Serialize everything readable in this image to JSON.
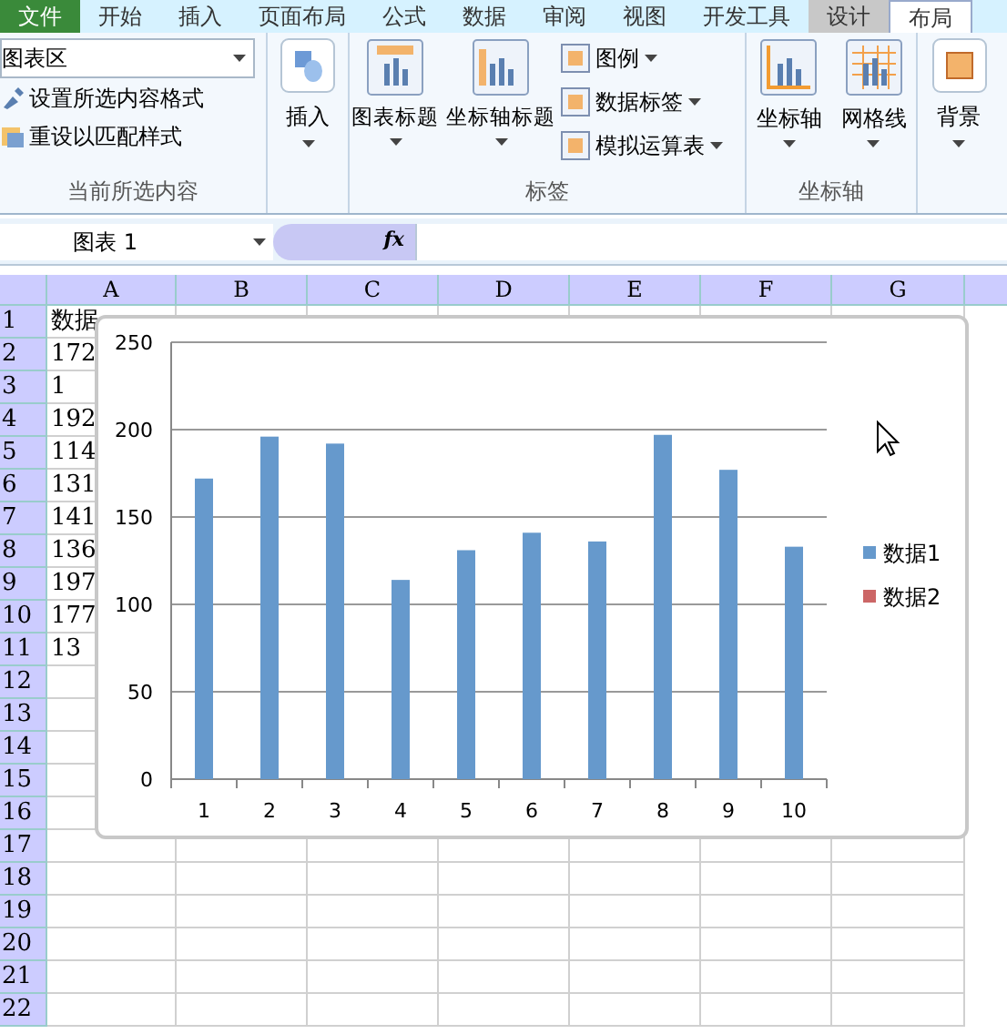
{
  "tabs": [
    {
      "label": "文件",
      "kind": "file",
      "selected": false
    },
    {
      "label": "开始",
      "kind": "plain",
      "selected": false
    },
    {
      "label": "插入",
      "kind": "plain",
      "selected": false
    },
    {
      "label": "页面布局",
      "kind": "plain",
      "selected": false
    },
    {
      "label": "公式",
      "kind": "plain",
      "selected": false
    },
    {
      "label": "数据",
      "kind": "plain",
      "selected": false
    },
    {
      "label": "审阅",
      "kind": "plain",
      "selected": false
    },
    {
      "label": "视图",
      "kind": "plain",
      "selected": false
    },
    {
      "label": "开发工具",
      "kind": "plain",
      "selected": false
    },
    {
      "label": "设计",
      "kind": "context",
      "selected": false
    },
    {
      "label": "布局",
      "kind": "context",
      "selected": true
    }
  ],
  "ribbon": {
    "current_selection": {
      "dropdown": "图表区",
      "buttons": [
        "设置所选内容格式",
        "重设以匹配样式"
      ],
      "label": "当前所选内容"
    },
    "insert": {
      "label": "插入"
    },
    "labels_group": {
      "large_buttons": [
        "图表标题",
        "坐标轴标题"
      ],
      "small_buttons": [
        "图例",
        "数据标签",
        "模拟运算表"
      ],
      "label": "标签"
    },
    "axes_group": {
      "large_buttons": [
        "坐标轴",
        "网格线"
      ],
      "label": "坐标轴"
    },
    "background": {
      "label": "背景"
    }
  },
  "formula_bar": {
    "name_box": "图表 1",
    "fx": "fx"
  },
  "sheet": {
    "columns": [
      "A",
      "B",
      "C",
      "D",
      "E",
      "F",
      "G"
    ],
    "rows": [
      {
        "number": "1",
        "a": "数据"
      },
      {
        "number": "2",
        "a": "172"
      },
      {
        "number": "3",
        "a": "1"
      },
      {
        "number": "4",
        "a": "192"
      },
      {
        "number": "5",
        "a": "114"
      },
      {
        "number": "6",
        "a": "131"
      },
      {
        "number": "7",
        "a": "141"
      },
      {
        "number": "8",
        "a": "136"
      },
      {
        "number": "9",
        "a": "197"
      },
      {
        "number": "10",
        "a": "177"
      },
      {
        "number": "11",
        "a": "13"
      },
      {
        "number": "12"
      },
      {
        "number": "13"
      },
      {
        "number": "14"
      },
      {
        "number": "15"
      },
      {
        "number": "16"
      },
      {
        "number": "17"
      },
      {
        "number": "18"
      },
      {
        "number": "19"
      },
      {
        "number": "20"
      },
      {
        "number": "21"
      },
      {
        "number": "22"
      }
    ]
  },
  "chart": {
    "chart_data": {
      "type": "bar",
      "grid": true,
      "categories": [
        "1",
        "2",
        "3",
        "4",
        "5",
        "6",
        "7",
        "8",
        "9",
        "10"
      ],
      "ylim": [
        0,
        250
      ],
      "yticks": [
        0,
        50,
        100,
        150,
        200,
        250
      ],
      "series": [
        {
          "name": "数据1",
          "color": "#6699cc",
          "values": [
            172,
            196,
            192,
            114,
            131,
            141,
            136,
            197,
            177,
            133
          ]
        },
        {
          "name": "数据2",
          "color": "#cc6666",
          "values": [
            null,
            null,
            null,
            null,
            null,
            null,
            null,
            null,
            null,
            null
          ]
        }
      ]
    }
  }
}
